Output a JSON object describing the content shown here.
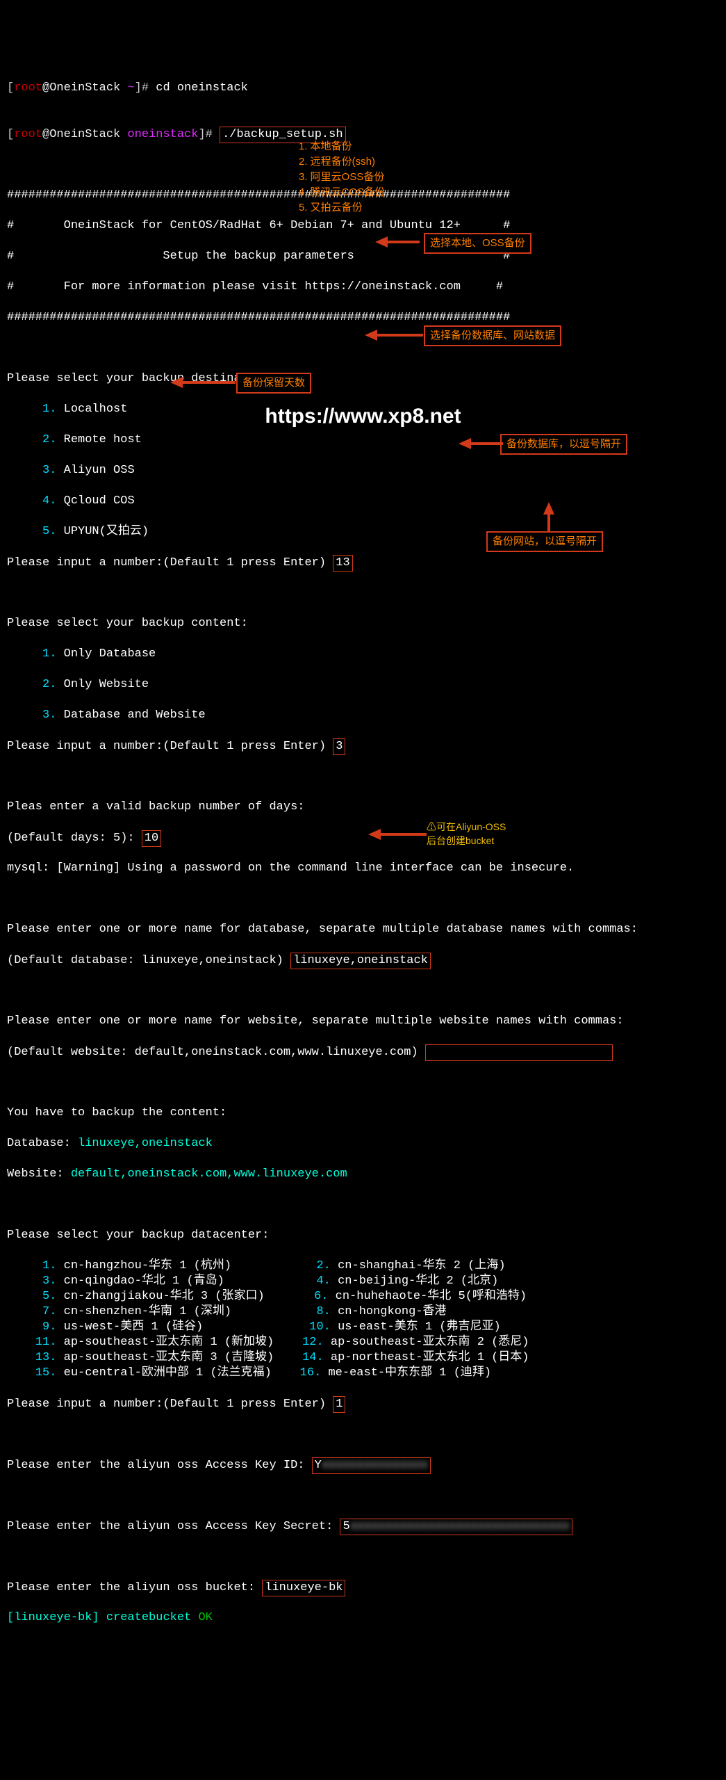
{
  "prompt1": {
    "bracket_l": "[",
    "user": "root",
    "at": "@",
    "host": "OneinStack",
    "sp": " ",
    "dir": "~",
    "bracket_r": "]",
    "hash": "# ",
    "cmd": "cd oneinstack"
  },
  "prompt2": {
    "dir": "oneinstack",
    "cmd": "./backup_setup.sh"
  },
  "banner": {
    "hr": "#######################################################################",
    "l1": "#       OneinStack for CentOS/RadHat 6+ Debian 7+ and Ubuntu 12+      #",
    "l2": "#                     Setup the backup parameters                     #",
    "l3": "#       For more information please visit https://oneinstack.com     #"
  },
  "dest": {
    "title": "Please select your backup destination:",
    "items": [
      {
        "n": "1.",
        "t": " Localhost"
      },
      {
        "n": "2.",
        "t": " Remote host"
      },
      {
        "n": "3.",
        "t": " Aliyun OSS"
      },
      {
        "n": "4.",
        "t": " Qcloud COS"
      },
      {
        "n": "5.",
        "t": " UPYUN(又拍云)"
      }
    ],
    "input_label": "Please input a number:(Default 1 press Enter) ",
    "input_val": "13"
  },
  "dest_notes": [
    "1. 本地备份",
    "2. 远程备份(ssh)",
    "3. 阿里云OSS备份",
    "4. 腾讯云COS备份",
    "5. 又拍云备份"
  ],
  "content": {
    "title": "Please select your backup content:",
    "items": [
      {
        "n": "1.",
        "t": " Only Database"
      },
      {
        "n": "2.",
        "t": " Only Website"
      },
      {
        "n": "3.",
        "t": " Database and Website"
      }
    ],
    "input_label": "Please input a number:(Default 1 press Enter) ",
    "input_val": "3"
  },
  "days": {
    "title": "Pleas enter a valid backup number of days:",
    "label": "(Default days: 5): ",
    "val": "10"
  },
  "mysql_warn": "mysql: [Warning] Using a password on the command line interface can be insecure.",
  "watermark": "https://www.xp8.net",
  "db": {
    "title": "Please enter one or more name for database, separate multiple database names with commas:",
    "label": "(Default database: linuxeye,oneinstack) ",
    "val": "linuxeye,oneinstack"
  },
  "site": {
    "title": "Please enter one or more name for website, separate multiple website names with commas:",
    "label": "(Default website: default,oneinstack.com,www.linuxeye.com) ",
    "valbox_empty": " "
  },
  "confirm": {
    "title": "You have to backup the content:",
    "db_label": "Database: ",
    "db_val": "linuxeye,oneinstack",
    "site_label": "Website: ",
    "site_val": "default,oneinstack.com,www.linuxeye.com"
  },
  "dc": {
    "title": "Please select your backup datacenter:",
    "rows": [
      [
        {
          "n": "1.",
          "t": " cn-hangzhou-华东 1 (杭州)"
        },
        {
          "n": "2.",
          "t": " cn-shanghai-华东 2 (上海)"
        }
      ],
      [
        {
          "n": "3.",
          "t": " cn-qingdao-华北 1 (青岛)"
        },
        {
          "n": "4.",
          "t": " cn-beijing-华北 2 (北京)"
        }
      ],
      [
        {
          "n": "5.",
          "t": " cn-zhangjiakou-华北 3 (张家口)"
        },
        {
          "n": "6.",
          "t": " cn-huhehaote-华北 5(呼和浩特)"
        }
      ],
      [
        {
          "n": "7.",
          "t": " cn-shenzhen-华南 1 (深圳)"
        },
        {
          "n": "8.",
          "t": " cn-hongkong-香港"
        }
      ],
      [
        {
          "n": "9.",
          "t": " us-west-美西 1 (硅谷)"
        },
        {
          "n": "10.",
          "t": " us-east-美东 1 (弗吉尼亚)"
        }
      ],
      [
        {
          "n": "11.",
          "t": " ap-southeast-亚太东南 1 (新加坡)"
        },
        {
          "n": "12.",
          "t": " ap-southeast-亚太东南 2 (悉尼)"
        }
      ],
      [
        {
          "n": "13.",
          "t": " ap-southeast-亚太东南 3 (吉隆坡)"
        },
        {
          "n": "14.",
          "t": " ap-northeast-亚太东北 1 (日本)"
        }
      ],
      [
        {
          "n": "15.",
          "t": " eu-central-欧洲中部 1 (法兰克福)"
        },
        {
          "n": "16.",
          "t": " me-east-中东东部 1 (迪拜)"
        }
      ]
    ],
    "input_label": "Please input a number:(Default 1 press Enter) ",
    "input_val": "1"
  },
  "oss": {
    "ak_label": "Please enter the aliyun oss Access Key ID: ",
    "ak_val": "Y████████████████",
    "sk_label": "Please enter the aliyun oss Access Key Secret: ",
    "sk_val": "5████████████████████████████████",
    "bucket_label": "Please enter the aliyun oss bucket: ",
    "bucket_val": "linuxeye-bk",
    "result_prefix": "[",
    "result_name": "linuxeye-bk",
    "result_suffix": "] createbucket ",
    "result_ok": "OK"
  },
  "annotations": {
    "a_dest": "选择本地、OSS备份",
    "a_content": "选择备份数据库、网站数据",
    "a_days": "备份保留天数",
    "a_db": "备份数据库，以逗号隔开",
    "a_site": "备份网站，以逗号隔开",
    "a_bucket1": "⚠可在Aliyun-OSS",
    "a_bucket2": "后台创建bucket"
  }
}
